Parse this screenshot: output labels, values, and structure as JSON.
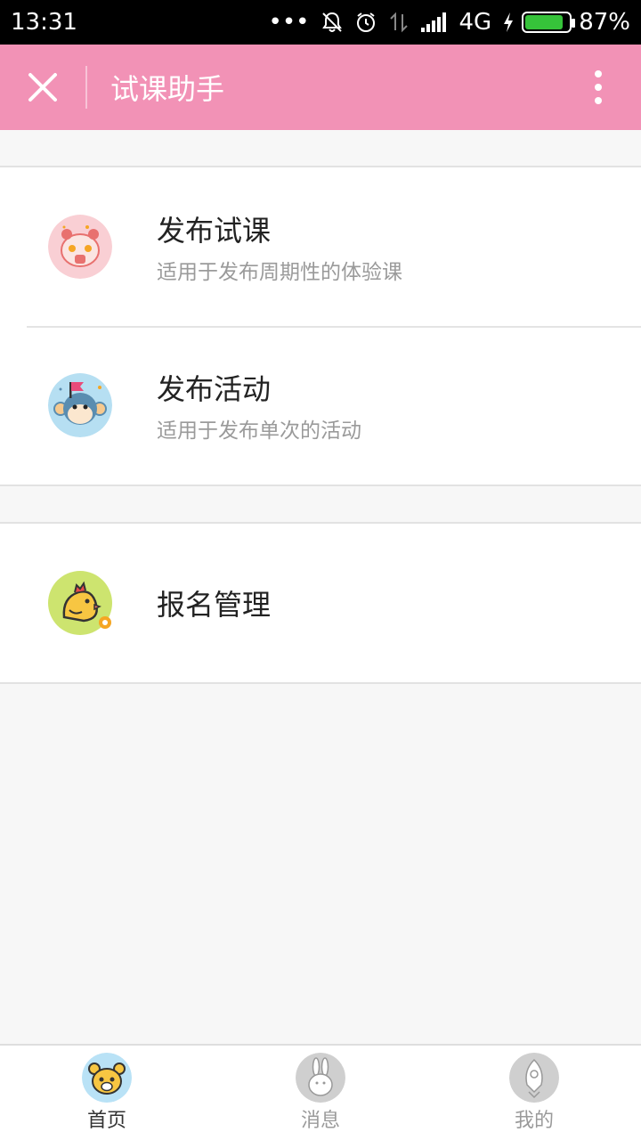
{
  "status_bar": {
    "time": "13:31",
    "dots": "•••",
    "network": "4G",
    "battery": "87%",
    "battery_level": 0.87
  },
  "header": {
    "title": "试课助手",
    "close_icon": "close-icon",
    "more_icon": "more-vertical-icon",
    "color": "#f292b6"
  },
  "menu": {
    "publish_course": {
      "title": "发布试课",
      "subtitle": "适用于发布周期性的体验课",
      "icon": "pig-icon"
    },
    "publish_event": {
      "title": "发布活动",
      "subtitle": "适用于发布单次的活动",
      "icon": "monkey-icon"
    },
    "signup_manage": {
      "title": "报名管理",
      "icon": "chick-icon"
    }
  },
  "tabs": [
    {
      "label": "首页",
      "icon": "bear-icon",
      "active": true
    },
    {
      "label": "消息",
      "icon": "rabbit-icon",
      "active": false
    },
    {
      "label": "我的",
      "icon": "fish-icon",
      "active": false
    }
  ]
}
